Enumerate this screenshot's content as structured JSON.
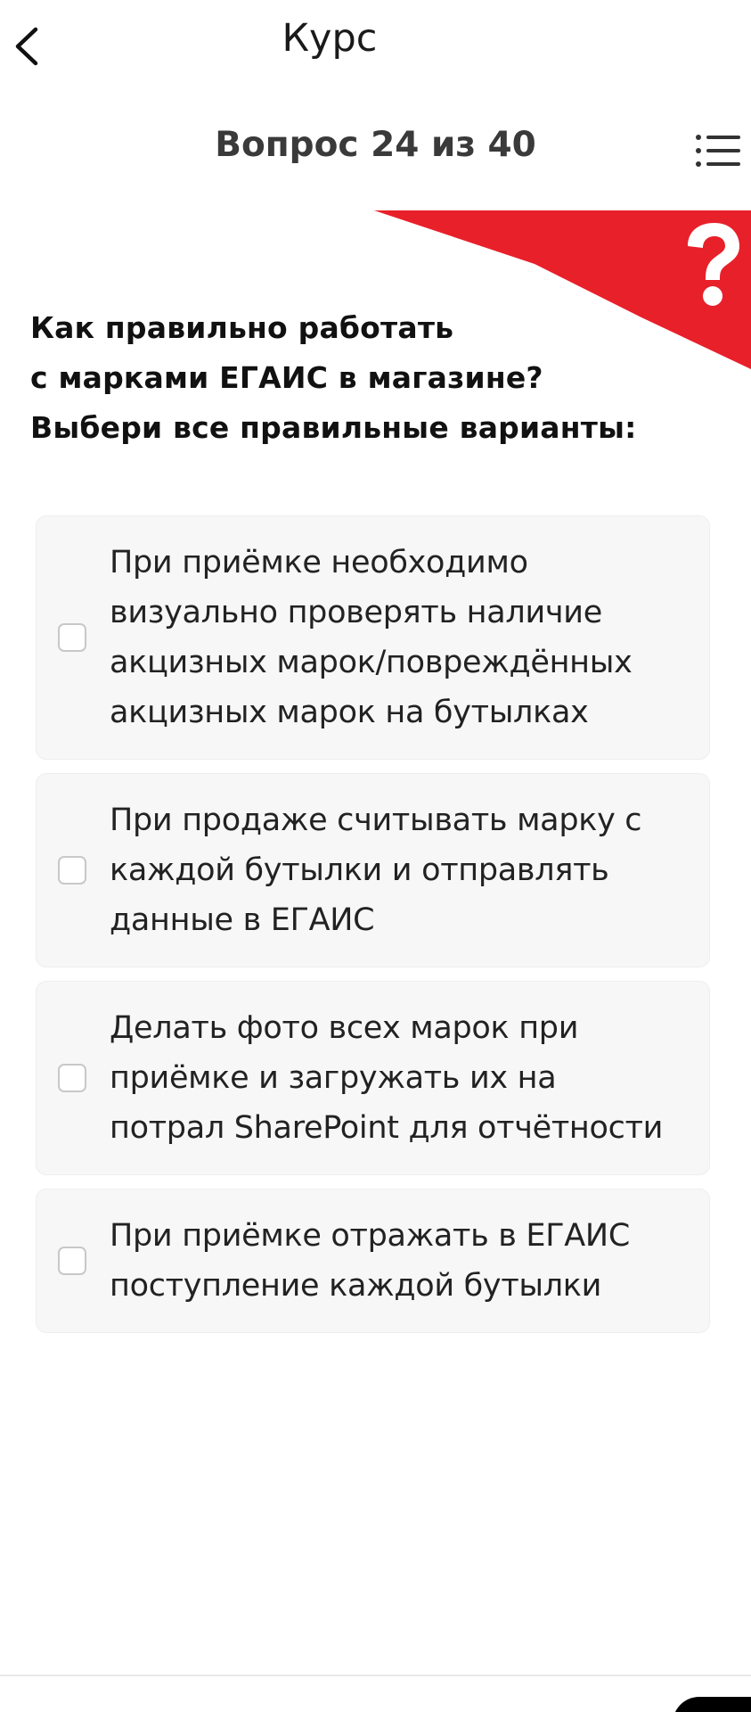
{
  "appbar": {
    "title": "Курс"
  },
  "counter": "Вопрос 24 из 40",
  "question": {
    "lines": [
      "Как правильно работать",
      "с марками ЕГАИС в магазине?",
      "Выбери все правильные варианты:"
    ]
  },
  "options": [
    {
      "lines": [
        "При приёмке необходимо",
        "визуально проверять наличие",
        "акцизных марок/повреждённых",
        "акцизных марок на бутылках"
      ],
      "checked": false
    },
    {
      "lines": [
        "При продаже считывать марку с",
        "каждой бутылки и отправлять",
        "данные в ЕГАИС"
      ],
      "checked": false
    },
    {
      "lines": [
        "Делать фото всех марок при",
        "приёмке и загружать их на",
        "потрал SharePoint для отчётности"
      ],
      "checked": false
    },
    {
      "lines": [
        "При приёмке отражать в ЕГАИС",
        "поступление каждой бутылки"
      ],
      "checked": false
    }
  ],
  "colors": {
    "accent": "#e8202a",
    "card": "#f7f7f7",
    "checkbox_border": "#c8c8c8"
  },
  "icons": {
    "back": "chevron-left-icon",
    "list": "list-menu-icon",
    "question_mark": "question-mark-icon"
  }
}
